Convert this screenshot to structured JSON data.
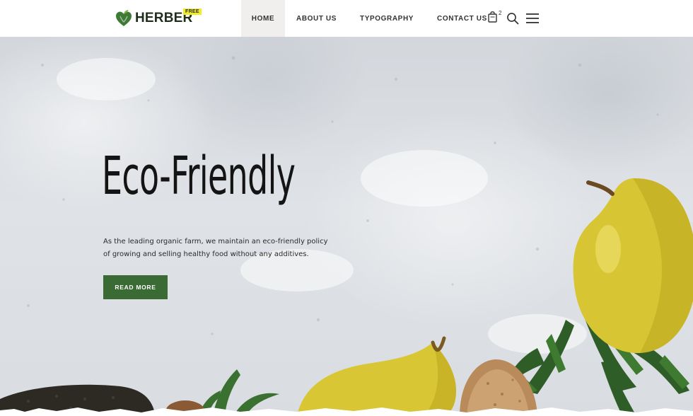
{
  "brand": {
    "name": "HERBER",
    "badge": "FREE",
    "icon": "leaf-heart-icon"
  },
  "nav": {
    "items": [
      {
        "label": "HOME",
        "active": true
      },
      {
        "label": "ABOUT US"
      },
      {
        "label": "TYPOGRAPHY"
      },
      {
        "label": "CONTACT US"
      }
    ]
  },
  "tools": {
    "cart_icon": "shopping-bag-icon",
    "cart_count": "2",
    "search_icon": "search-icon",
    "menu_icon": "hamburger-menu-icon"
  },
  "hero": {
    "title": "Eco-Friendly",
    "description": "As the leading organic farm, we maintain an eco-friendly policy of growing and selling healthy food without any additives.",
    "button_label": "READ MORE"
  },
  "colors": {
    "accent": "#3a6b35",
    "badge": "#f3ea2c",
    "active_nav_bg": "#f1efed"
  }
}
